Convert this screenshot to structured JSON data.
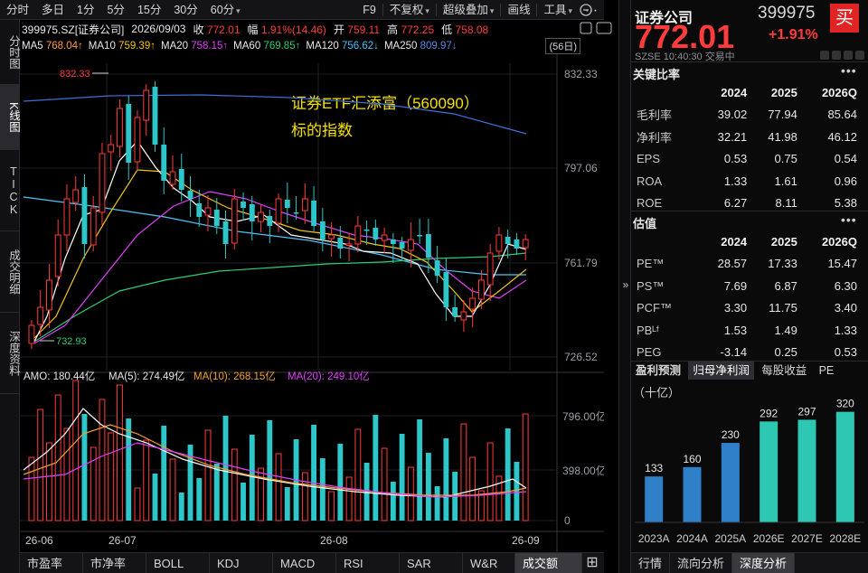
{
  "toolbar": {
    "items": [
      "分时",
      "多日",
      "1分",
      "5分",
      "15分",
      "30分",
      "60分"
    ],
    "right_items": [
      "F9",
      "不复权",
      "超级叠加",
      "画线",
      "工具"
    ]
  },
  "left_tabs": [
    "分时图",
    "K线图",
    "TICK",
    "成交明细",
    "深度资料"
  ],
  "info": {
    "code": "399975.SZ[证券公司]",
    "date": "2026/09/03",
    "close_label": "收",
    "close": "772.01",
    "change_label": "幅",
    "change": "1.91%(14.46)",
    "open_label": "开",
    "open": "759.11",
    "high_label": "高",
    "high": "772.25",
    "low_label": "低",
    "low": "758.08"
  },
  "ma": {
    "ma5_label": "MA5",
    "ma5": "768.04↑",
    "ma10_label": "MA10",
    "ma10": "759.39↑",
    "ma20_label": "MA20",
    "ma20": "758.15↑",
    "ma60_label": "MA60",
    "ma60": "769.85↑",
    "ma120_label": "MA120",
    "ma120": "756.62↓",
    "ma250_label": "MA250",
    "ma250": "809.97↓",
    "days": "(56日)"
  },
  "annotation": {
    "line1": "证券ETF汇添富（560090）",
    "line2": "标的指数"
  },
  "price_axis": [
    "832.33",
    "797.06",
    "761.79",
    "726.52"
  ],
  "marks": {
    "high": "832.33",
    "low": "732.93"
  },
  "volume": {
    "amo_label": "AMO: 180.44亿",
    "ma5": "MA(5): 274.49亿",
    "ma10": "MA(10): 268.15亿",
    "ma20": "MA(20): 249.10亿",
    "axis": [
      "796.00亿",
      "398.00亿",
      "0"
    ]
  },
  "date_axis": [
    "26-06",
    "26-07",
    "26-08",
    "26-09"
  ],
  "bottom_tabs": [
    "市盈率",
    "市净率",
    "BOLL",
    "KDJ",
    "MACD",
    "RSI",
    "SAR",
    "W&R",
    "成交额"
  ],
  "right": {
    "name": "证券公司",
    "code": "399975",
    "buy": "买",
    "price": "772.01",
    "change_pct": "+1.91%",
    "market": "SZSE",
    "time": "10:40:30",
    "status": "交易中",
    "ratios_title": "关键比率",
    "years": [
      "2024",
      "2025",
      "2026Q"
    ],
    "ratios": [
      {
        "label": "毛利率",
        "v": [
          "39.02",
          "77.94",
          "85.64"
        ]
      },
      {
        "label": "净利率",
        "v": [
          "32.21",
          "41.98",
          "46.12"
        ]
      },
      {
        "label": "EPS",
        "v": [
          "0.53",
          "0.75",
          "0.54"
        ]
      },
      {
        "label": "ROA",
        "v": [
          "1.33",
          "1.61",
          "0.96"
        ]
      },
      {
        "label": "ROE",
        "v": [
          "6.27",
          "8.11",
          "5.38"
        ]
      }
    ],
    "valuation_title": "估值",
    "valuation": [
      {
        "label": "PE™",
        "v": [
          "28.57",
          "17.33",
          "15.47"
        ]
      },
      {
        "label": "PS™",
        "v": [
          "7.69",
          "6.87",
          "6.30"
        ]
      },
      {
        "label": "PCF™",
        "v": [
          "3.30",
          "11.75",
          "3.40"
        ]
      },
      {
        "label": "PBᴸᶠ",
        "v": [
          "1.53",
          "1.49",
          "1.33"
        ]
      },
      {
        "label": "PEG",
        "v": [
          "-3.14",
          "0.25",
          "0.53"
        ]
      }
    ],
    "forecast_tabs": [
      "盈利预测",
      "归母净利润",
      "每股收益",
      "PE"
    ],
    "forecast_unit": "（十亿）",
    "bottom_tabs": [
      "行情",
      "流向分析",
      "深度分析"
    ]
  },
  "chart_data": {
    "type": "bar",
    "categories": [
      "2023A",
      "2024A",
      "2025A",
      "2026E",
      "2027E",
      "2028E"
    ],
    "values": [
      133,
      160,
      230,
      292,
      297,
      320
    ],
    "title": "",
    "ylim": [
      0,
      340
    ]
  },
  "colors": {
    "up": "#ff3b3b",
    "down": "#2ec7c9",
    "ma5": "#ffffff",
    "ma10": "#f0c419",
    "ma20": "#e040fb",
    "ma60": "#2ecc71",
    "ma120": "#4fc3f7",
    "ma250": "#3f6fd8",
    "bar_a": "#2f7fc9",
    "bar_e": "#2ec7b4"
  }
}
